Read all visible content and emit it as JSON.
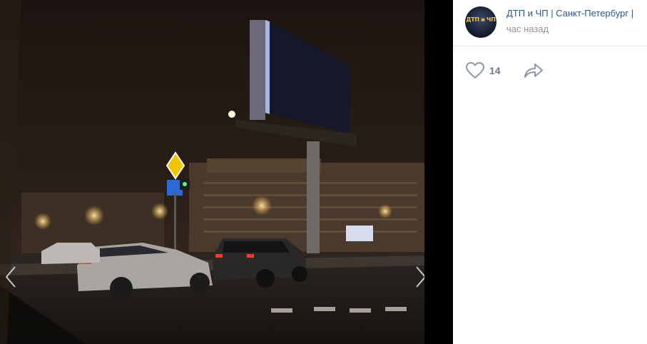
{
  "post": {
    "group_name": "ДТП и ЧП | Санкт-Петербург |",
    "avatar_text": "ДТП и ЧП",
    "time": "час назад"
  },
  "actions": {
    "like_count": "14"
  },
  "icons": {
    "like": "heart-icon",
    "share": "share-arrow-icon",
    "prev": "chevron-left-icon",
    "next": "chevron-right-icon"
  },
  "colors": {
    "link": "#2a5885",
    "muted": "#939393",
    "icon": "#8a98a8"
  }
}
